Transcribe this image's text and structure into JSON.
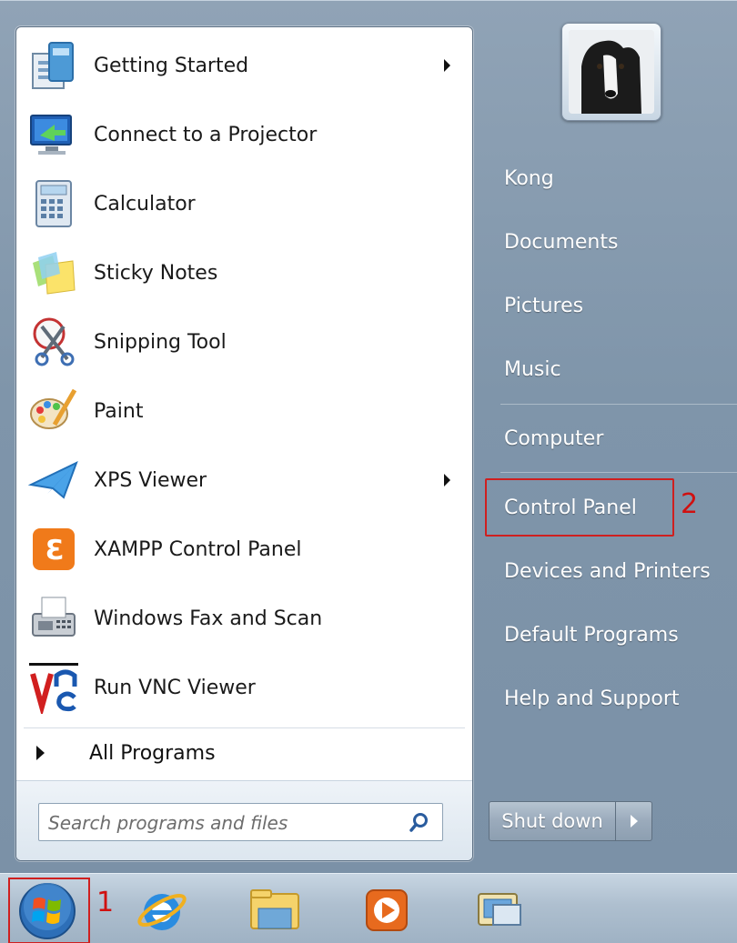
{
  "programs": [
    {
      "label": "Getting Started",
      "icon": "getting-started-icon",
      "has_submenu": true
    },
    {
      "label": "Connect to a Projector",
      "icon": "projector-icon",
      "has_submenu": false
    },
    {
      "label": "Calculator",
      "icon": "calculator-icon",
      "has_submenu": false
    },
    {
      "label": "Sticky Notes",
      "icon": "sticky-notes-icon",
      "has_submenu": false
    },
    {
      "label": "Snipping Tool",
      "icon": "snipping-tool-icon",
      "has_submenu": false
    },
    {
      "label": "Paint",
      "icon": "paint-icon",
      "has_submenu": false
    },
    {
      "label": "XPS Viewer",
      "icon": "xps-viewer-icon",
      "has_submenu": true
    },
    {
      "label": "XAMPP Control Panel",
      "icon": "xampp-icon",
      "has_submenu": false
    },
    {
      "label": "Windows Fax and Scan",
      "icon": "fax-scan-icon",
      "has_submenu": false
    },
    {
      "label": "Run VNC Viewer",
      "icon": "vnc-icon",
      "has_submenu": false
    }
  ],
  "all_programs": {
    "label": "All Programs"
  },
  "search": {
    "placeholder": "Search programs and files"
  },
  "right_pane": {
    "items": [
      {
        "label": "Kong"
      },
      {
        "label": "Documents"
      },
      {
        "label": "Pictures"
      },
      {
        "label": "Music"
      },
      {
        "label": "Computer"
      },
      {
        "label": "Control Panel"
      },
      {
        "label": "Devices and Printers"
      },
      {
        "label": "Default Programs"
      },
      {
        "label": "Help and Support"
      }
    ]
  },
  "shutdown": {
    "label": "Shut down"
  },
  "annotations": {
    "start_marker": "1",
    "control_panel_marker": "2"
  },
  "colors": {
    "highlight": "#cf1f1f",
    "menu_bg": "#8a9eb2"
  }
}
